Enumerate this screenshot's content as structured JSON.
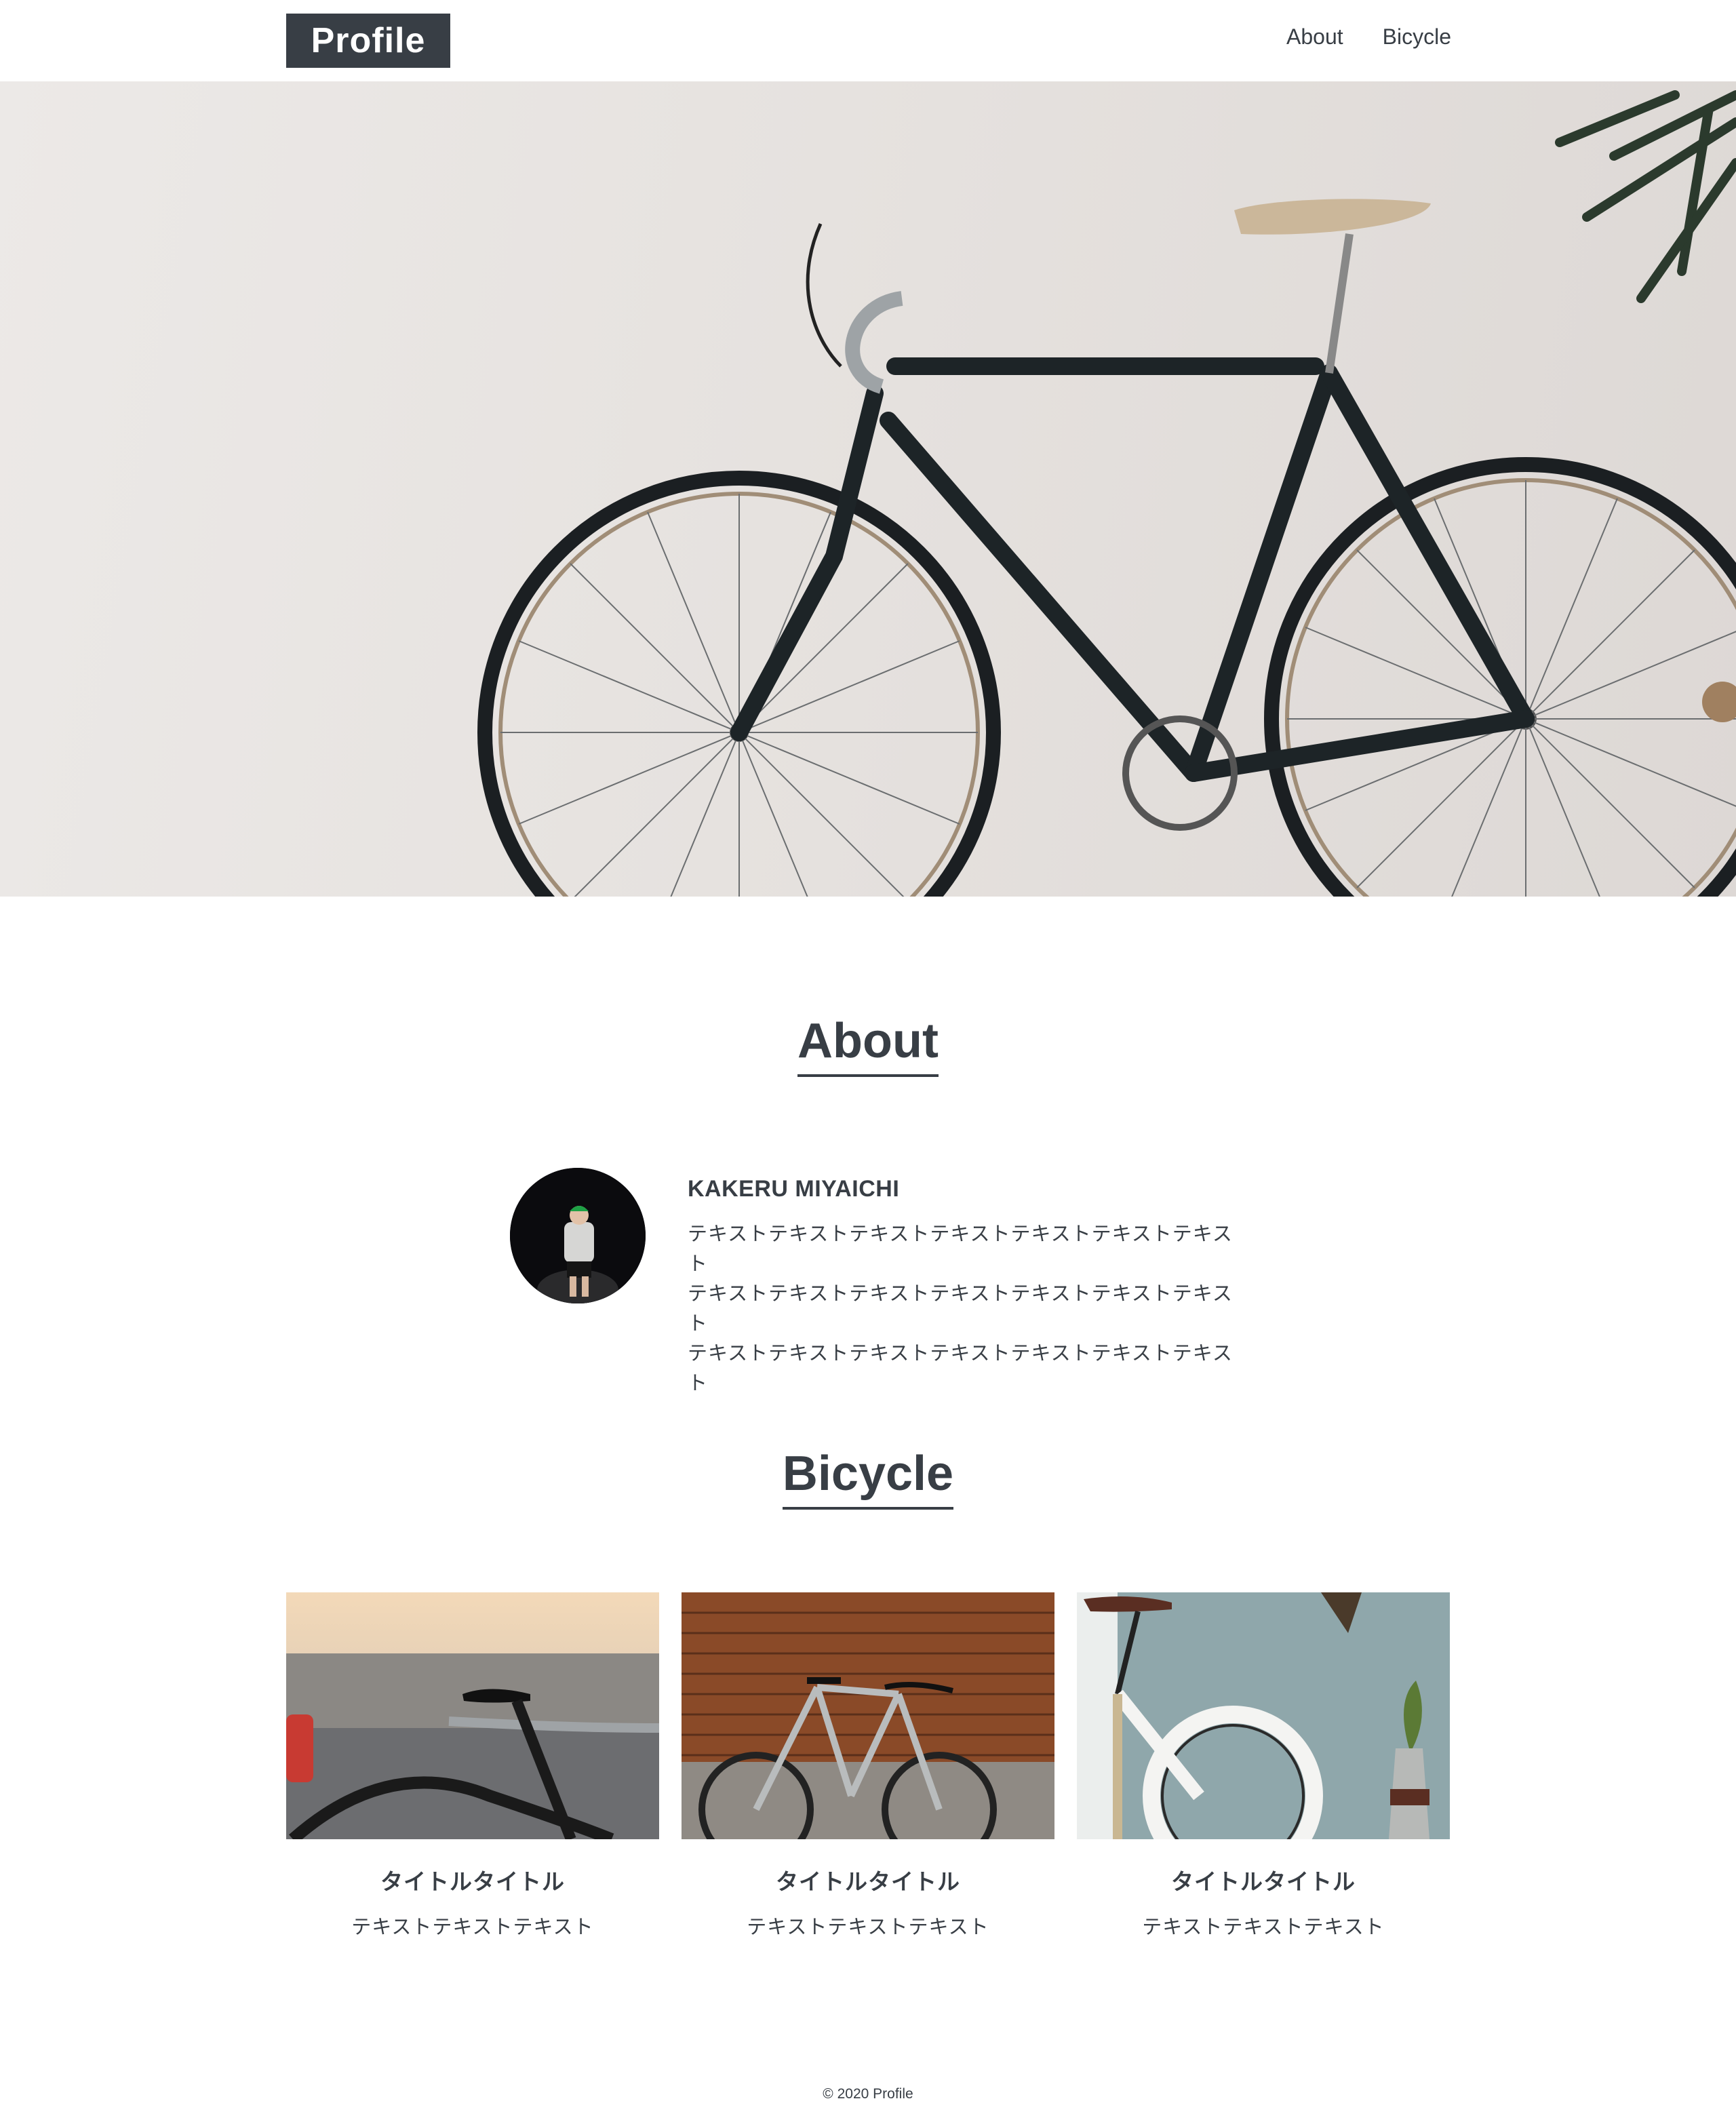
{
  "header": {
    "logo": "Profile",
    "nav": [
      "About",
      "Bicycle"
    ]
  },
  "about": {
    "title": "About",
    "name": "KAKERU MIYAICHI",
    "text_lines": [
      "テキストテキストテキストテキストテキストテキストテキスト",
      "テキストテキストテキストテキストテキストテキストテキスト",
      "テキストテキストテキストテキストテキストテキストテキスト"
    ]
  },
  "bicycle": {
    "title": "Bicycle",
    "cards": [
      {
        "title": "タイトルタイトル",
        "text": "テキストテキストテキスト"
      },
      {
        "title": "タイトルタイトル",
        "text": "テキストテキストテキスト"
      },
      {
        "title": "タイトルタイトル",
        "text": "テキストテキストテキスト"
      }
    ]
  },
  "footer": {
    "copyright": "© 2020 Profile"
  },
  "colors": {
    "primary": "#383e45",
    "background": "#ffffff"
  }
}
